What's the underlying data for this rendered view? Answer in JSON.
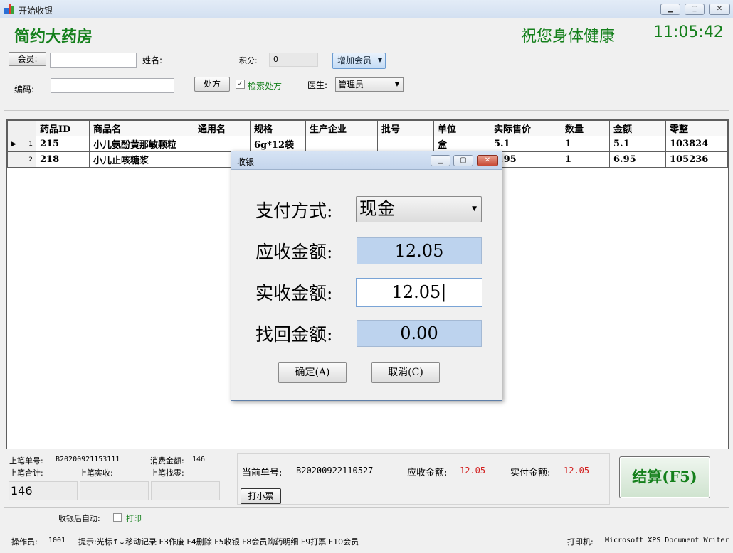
{
  "window": {
    "title": "开始收银"
  },
  "header": {
    "store_name": "简约大药房",
    "greeting": "祝您身体健康",
    "clock": "11:05:42"
  },
  "form": {
    "member_button": "会员:",
    "member_value": "",
    "name_label": "姓名:",
    "points_label": "积分:",
    "points_value": "0",
    "add_member_button": "增加会员",
    "code_label": "编码:",
    "code_value": "",
    "prescription_button": "处方",
    "search_prescription_label": "检索处方",
    "search_prescription_checked": true,
    "doctor_label": "医生:",
    "doctor_value": "管理员"
  },
  "table": {
    "columns": [
      "药品ID",
      "商品名",
      "通用名",
      "规格",
      "生产企业",
      "批号",
      "单位",
      "实际售价",
      "数量",
      "金额",
      "零整"
    ],
    "rows": [
      {
        "rownum": "1",
        "id": "215",
        "name": "小儿氨酚黄那敏颗粒",
        "generic": "",
        "spec": "6g*12袋",
        "maker": "",
        "batch": "",
        "unit": "盒",
        "price": "5.1",
        "qty": "1",
        "amount": "5.1",
        "code": "103824"
      },
      {
        "rownum": "2",
        "id": "218",
        "name": "小儿止咳糖浆",
        "generic": "",
        "spec": "",
        "maker": "",
        "batch": "",
        "unit": "",
        "price": "6.95",
        "qty": "1",
        "amount": "6.95",
        "code": "105236"
      }
    ]
  },
  "dialog": {
    "title": "收银",
    "pay_method_label": "支付方式:",
    "pay_method_value": "现金",
    "due_label": "应收金额:",
    "due_value": "12.05",
    "received_label": "实收金额:",
    "received_value": "12.05",
    "change_label": "找回金额:",
    "change_value": "0.00",
    "ok_button": "确定(A)",
    "cancel_button": "取消(C)"
  },
  "last_bill": {
    "order_label": "上笔单号:",
    "order_value": "B20200921153111",
    "consume_label": "消费金额:",
    "consume_value": "146",
    "total_label": "上笔合计:",
    "received_label": "上笔实收:",
    "change_label": "上笔找零:",
    "total_value": "146",
    "received_value": "",
    "change_value": ""
  },
  "current": {
    "order_label": "当前单号:",
    "order_value": "B20200922110527",
    "due_label": "应收金额:",
    "due_value": "12.05",
    "paid_label": "实付金额:",
    "paid_value": "12.05",
    "print_receipt_button": "打小票",
    "settle_button": "结算(F5)"
  },
  "auto": {
    "label": "收银后自动:",
    "print_label": "打印",
    "print_checked": false
  },
  "status": {
    "operator_label": "操作员:",
    "operator_value": "1001",
    "hint": "提示:光标↑↓移动记录 F3作废 F4删除 F5收银 F8会员购药明细 F9打票 F10会员",
    "printer_label": "打印机:",
    "printer_value": "Microsoft XPS Document Writer"
  },
  "colors": {
    "accent_green": "#15801c",
    "amount_red": "#d21c1c",
    "field_blue": "#bdd3ee"
  }
}
